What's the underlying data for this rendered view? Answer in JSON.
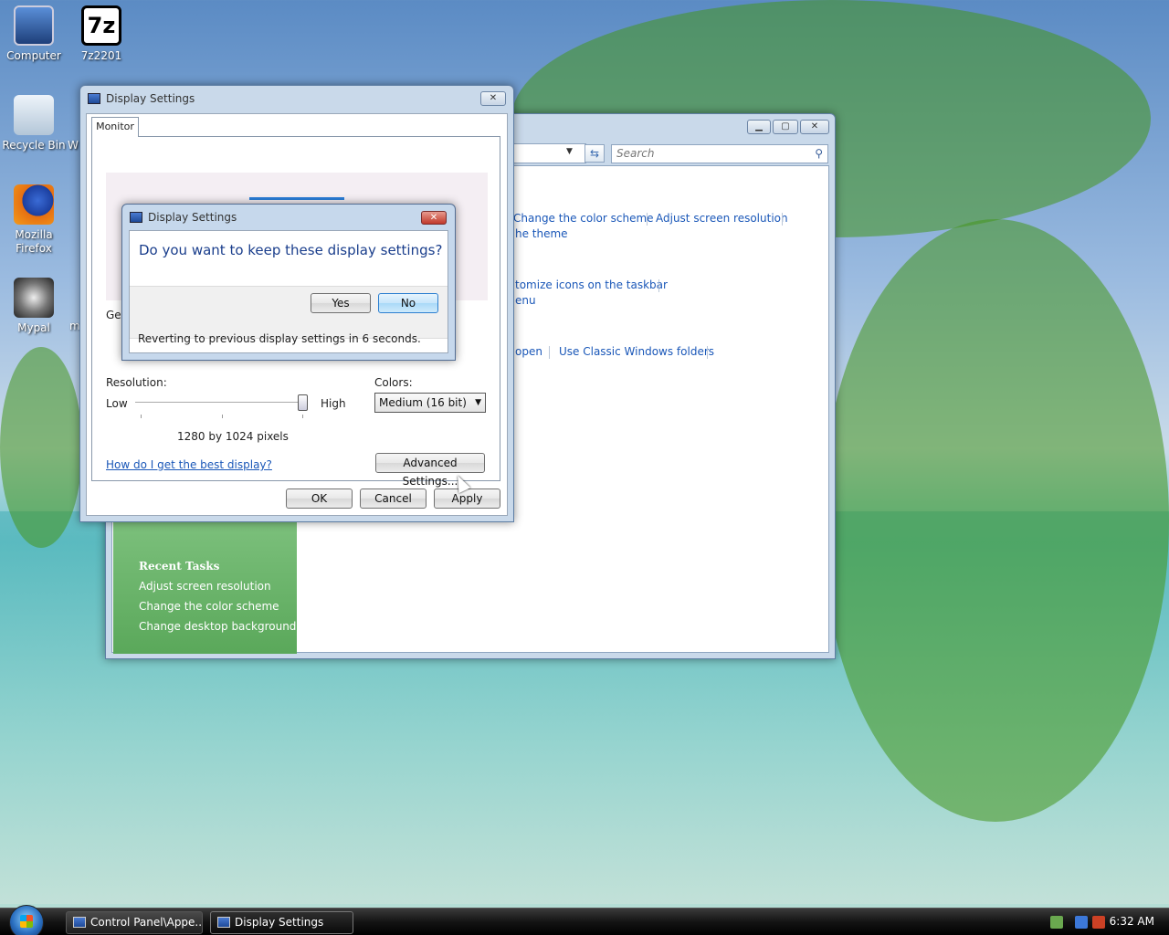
{
  "desktop": {
    "icons": [
      {
        "label": "Computer",
        "icon": "computer-icon"
      },
      {
        "label": "7z2201",
        "icon": "7zip-icon",
        "glyph": "7z"
      },
      {
        "label": "Recycle Bin",
        "icon": "recycle-bin-icon"
      },
      {
        "label": "W",
        "icon": "partial-icon"
      },
      {
        "label": "Mozilla Firefox",
        "icon": "firefox-icon"
      },
      {
        "label": "Mypal",
        "icon": "mypal-icon"
      },
      {
        "label": "m",
        "icon": "partial-icon"
      }
    ]
  },
  "control_panel": {
    "search_placeholder": "Search",
    "links": [
      "Change the color scheme",
      "Adjust screen resolution",
      "he theme",
      "tomize icons on the taskbar",
      "enu",
      "open",
      "Use Classic Windows folders"
    ],
    "recent_tasks": {
      "heading": "Recent Tasks",
      "items": [
        "Adjust screen resolution",
        "Change the color scheme",
        "Change desktop background"
      ]
    }
  },
  "display_settings": {
    "title": "Display Settings",
    "tab": "Monitor",
    "partial_label": "Ger",
    "resolution_label": "Resolution:",
    "low_label": "Low",
    "high_label": "High",
    "resolution_value": "1280 by 1024 pixels",
    "resolution_slider_position": 1.0,
    "colors_label": "Colors:",
    "colors_value": "Medium (16 bit)",
    "help_link": "How do I get the best display?",
    "advanced_button": "Advanced Settings...",
    "ok_button": "OK",
    "cancel_button": "Cancel",
    "apply_button": "Apply"
  },
  "confirm_dialog": {
    "title": "Display Settings",
    "question": "Do you want to keep these display settings?",
    "yes_button": "Yes",
    "no_button": "No",
    "countdown_text": "Reverting to previous display settings in 6 seconds."
  },
  "taskbar": {
    "tasks": [
      "Control Panel\\Appe...",
      "Display Settings"
    ],
    "clock": "6:32 AM"
  },
  "colors": {
    "link": "#1a57b8",
    "sidebar_green": "#6ab46a",
    "focus_blue": "#2c7fd0"
  }
}
